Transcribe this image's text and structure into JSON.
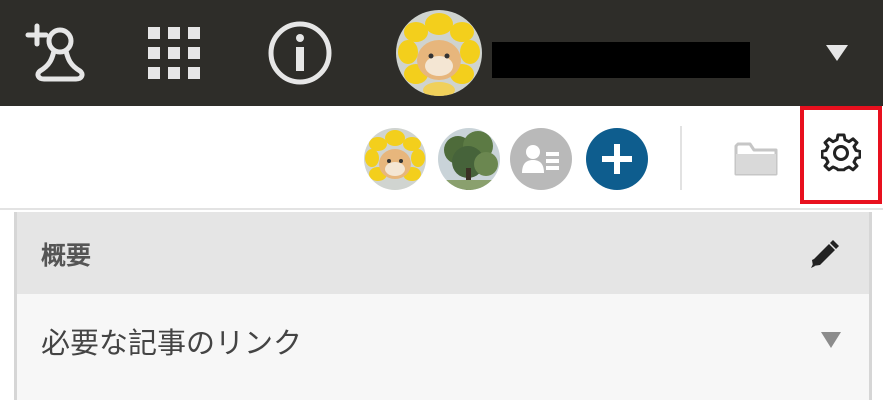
{
  "topbar": {
    "icons": {
      "add_user": "add-person-icon",
      "apps": "apps-grid-icon",
      "info": "info-icon",
      "caret": "caret-down-icon"
    },
    "colors": {
      "background": "#2e2d29",
      "icon": "#e6e6e6"
    }
  },
  "toolbar": {
    "colors": {
      "add_button": "#0e5d8e",
      "highlight": "#e8101e"
    }
  },
  "section": {
    "title": "概要",
    "row_label": "必要な記事のリンク"
  }
}
